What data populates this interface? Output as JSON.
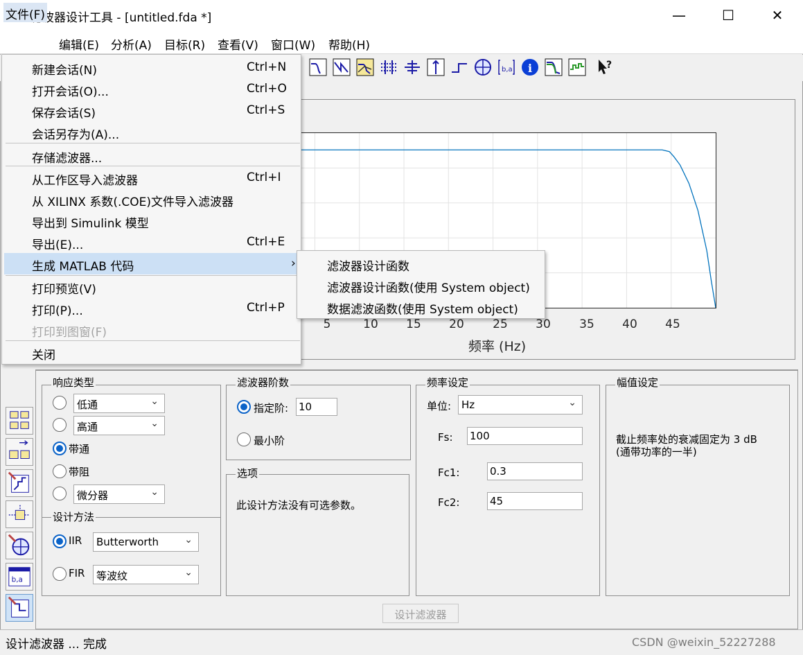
{
  "window": {
    "title": "滤波器设计工具 -  [untitled.fda *]",
    "minimize_glyph": "—",
    "maximize_glyph": "☐",
    "close_glyph": "✕"
  },
  "menubar": {
    "items": [
      "文件(F)",
      "编辑(E)",
      "分析(A)",
      "目标(R)",
      "查看(V)",
      "窗口(W)",
      "帮助(H)"
    ]
  },
  "file_menu": {
    "items": [
      {
        "label": "新建会话(N)",
        "shortcut": "Ctrl+N"
      },
      {
        "label": "打开会话(O)...",
        "shortcut": "Ctrl+O"
      },
      {
        "label": "保存会话(S)",
        "shortcut": "Ctrl+S"
      },
      {
        "label": "会话另存为(A)...",
        "shortcut": ""
      },
      {
        "label": "存储滤波器...",
        "shortcut": ""
      },
      {
        "label": "从工作区导入滤波器",
        "shortcut": "Ctrl+I"
      },
      {
        "label": "从 XILINX 系数(.COE)文件导入滤波器",
        "shortcut": ""
      },
      {
        "label": "导出到 Simulink 模型",
        "shortcut": ""
      },
      {
        "label": "导出(E)...",
        "shortcut": "Ctrl+E"
      },
      {
        "label": "生成 MATLAB 代码",
        "shortcut": "",
        "arrow": "›"
      },
      {
        "label": "打印预览(V)",
        "shortcut": ""
      },
      {
        "label": "打印(P)...",
        "shortcut": "Ctrl+P"
      },
      {
        "label": "打印到图窗(F)",
        "shortcut": ""
      },
      {
        "label": "关闭",
        "shortcut": ""
      }
    ]
  },
  "submenu": {
    "items": [
      "滤波器设计函数",
      "滤波器设计函数(使用 System object)",
      "数据滤波函数(使用 System object)"
    ]
  },
  "toolbar": {
    "icons": [
      "magnitude-response-icon",
      "phase-response-icon",
      "magnitude-phase-icon",
      "group-delay-icon",
      "phase-delay-icon",
      "impulse-response-icon",
      "step-response-icon",
      "pole-zero-icon",
      "coefficients-icon",
      "info-icon",
      "magnitude-estimate-icon",
      "noise-power-icon",
      "whats-this-icon"
    ]
  },
  "plot": {
    "xlabel": "频率 (Hz)",
    "xticks": [
      "5",
      "10",
      "15",
      "20",
      "25",
      "30",
      "35",
      "40",
      "45"
    ]
  },
  "chart_data": {
    "type": "line",
    "title": "",
    "xlabel": "频率 (Hz)",
    "ylabel": "",
    "xlim": [
      2.4,
      50
    ],
    "ylim": [
      -4.7,
      0.5
    ],
    "grid": true,
    "series": [
      {
        "x": [
          2.4,
          40,
          43,
          44,
          44.8,
          45.3,
          46,
          47,
          48,
          49,
          49.5,
          50
        ],
        "y": [
          0,
          0,
          0,
          0,
          -0.05,
          -0.2,
          -0.45,
          -1.0,
          -1.8,
          -3.0,
          -3.9,
          -4.7
        ]
      }
    ]
  },
  "response_type": {
    "title": "响应类型",
    "options": [
      {
        "type": "select",
        "value": "低通",
        "selected": false
      },
      {
        "type": "select",
        "value": "高通",
        "selected": false
      },
      {
        "type": "label",
        "value": "带通",
        "selected": true
      },
      {
        "type": "label",
        "value": "带阻",
        "selected": false
      },
      {
        "type": "select",
        "value": "微分器",
        "selected": false
      }
    ]
  },
  "design_method": {
    "title": "设计方法",
    "iir_label": "IIR",
    "iir_value": "Butterworth",
    "fir_label": "FIR",
    "fir_value": "等波纹"
  },
  "filter_order": {
    "title": "滤波器阶数",
    "specify_label": "指定阶:",
    "specify_value": "10",
    "min_label": "最小阶"
  },
  "options": {
    "title": "选项",
    "text": "此设计方法没有可选参数。"
  },
  "freq_spec": {
    "title": "频率设定",
    "units_label": "单位:",
    "units_value": "Hz",
    "fs_label": "Fs:",
    "fs_value": "100",
    "fc1_label": "Fc1:",
    "fc1_value": "0.3",
    "fc2_label": "Fc2:",
    "fc2_value": "45"
  },
  "mag_spec": {
    "title": "幅值设定",
    "text_line1": "截止频率处的衰减固定为 3 dB",
    "text_line2": "(通带功率的一半)"
  },
  "design_button": "设计滤波器",
  "status": "设计滤波器 ... 完成",
  "watermark": "CSDN @weixin_52227288",
  "colors": {
    "accent": "#0b63c8",
    "plot_line": "#0072bd",
    "menu_highlight": "#cce0f5"
  }
}
